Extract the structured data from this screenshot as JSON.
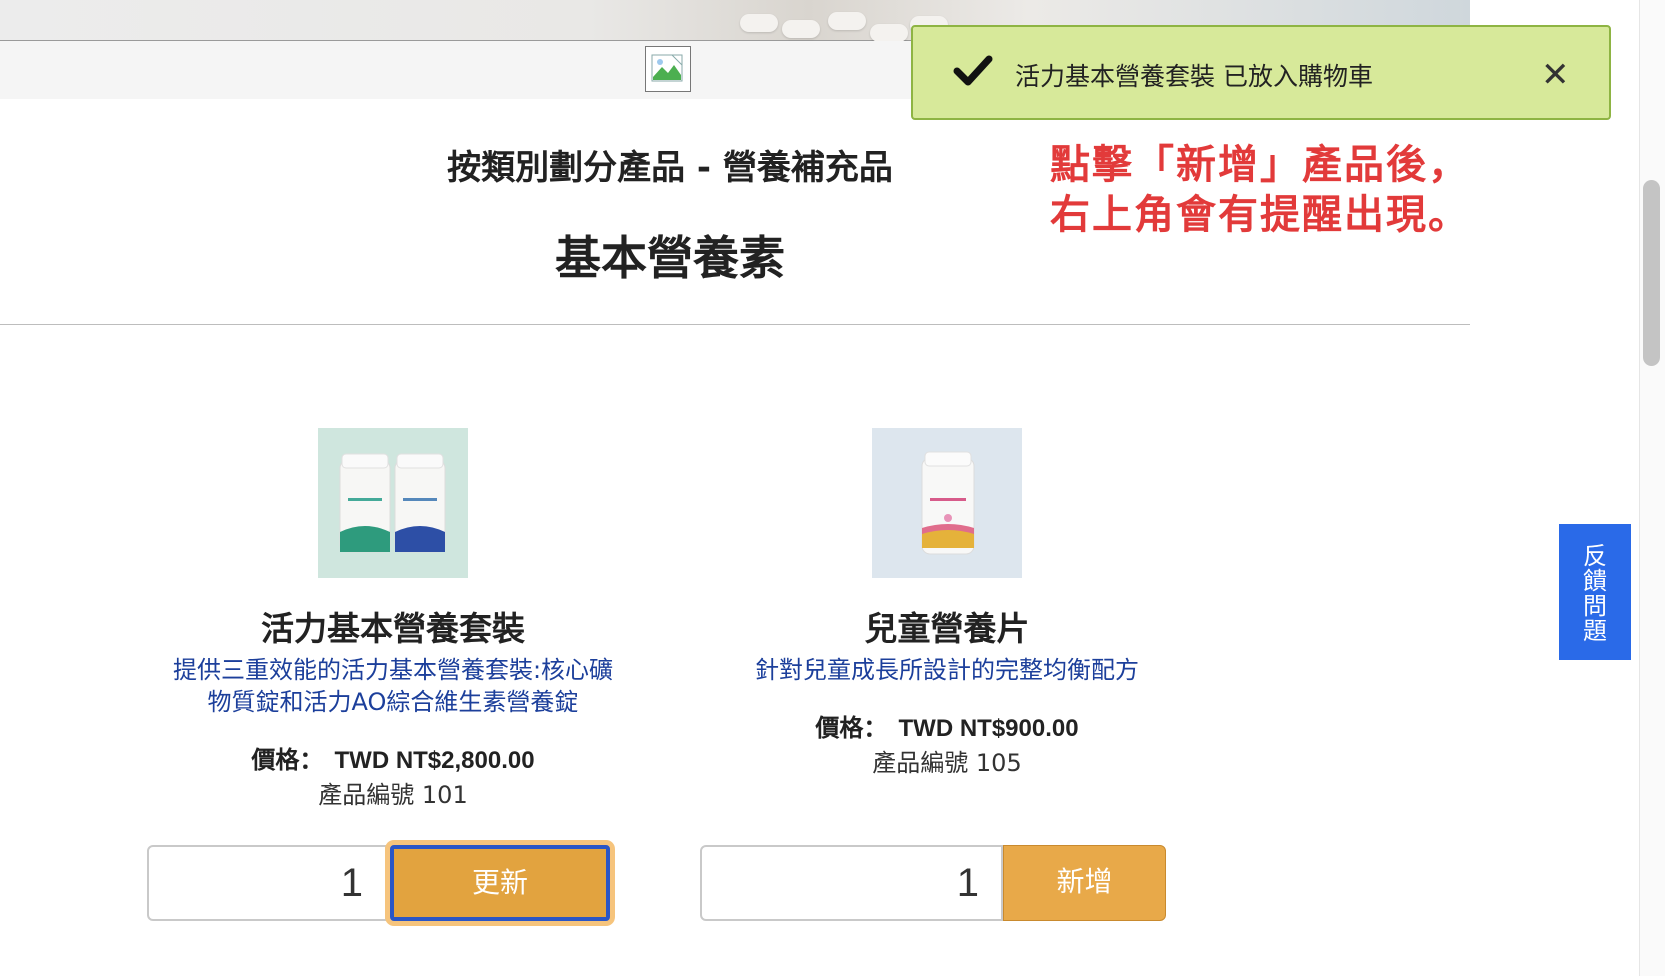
{
  "page": {
    "category_title": "按類別劃分產品 - 營養補充品",
    "section_title": "基本營養素"
  },
  "toast": {
    "message": "活力基本營養套裝 已放入購物車",
    "close_icon": "close-icon",
    "check_icon": "checkmark-icon",
    "background": "#d7e99a",
    "border": "#8eb443"
  },
  "annotation": {
    "line1": "點擊「新增」產品後，",
    "line2": "右上角會有提醒出現。",
    "color": "#e23a3a"
  },
  "products": [
    {
      "name": "活力基本營養套裝",
      "desc_line1": "提供三重效能的活力基本營養套裝:核心礦",
      "desc_line2": "物質錠和活力AO綜合維生素營養錠",
      "price_label": "價格：",
      "price": "TWD NT$2,800.00",
      "sku": "產品編號 101",
      "quantity": "1",
      "button": "更新"
    },
    {
      "name": "兒童營養片",
      "desc_line1": "針對兒童成長所設計的完整均衡配方",
      "price_label": "價格：",
      "price": "TWD NT$900.00",
      "sku": "產品編號 105",
      "quantity": "1",
      "button": "新增"
    }
  ],
  "feedback": {
    "label": "反饋問題",
    "color": "#2a6ae8"
  },
  "accent": {
    "button": "#e8a949",
    "focus_ring": "#2a56c6",
    "desc_text": "#1c3f9b"
  }
}
